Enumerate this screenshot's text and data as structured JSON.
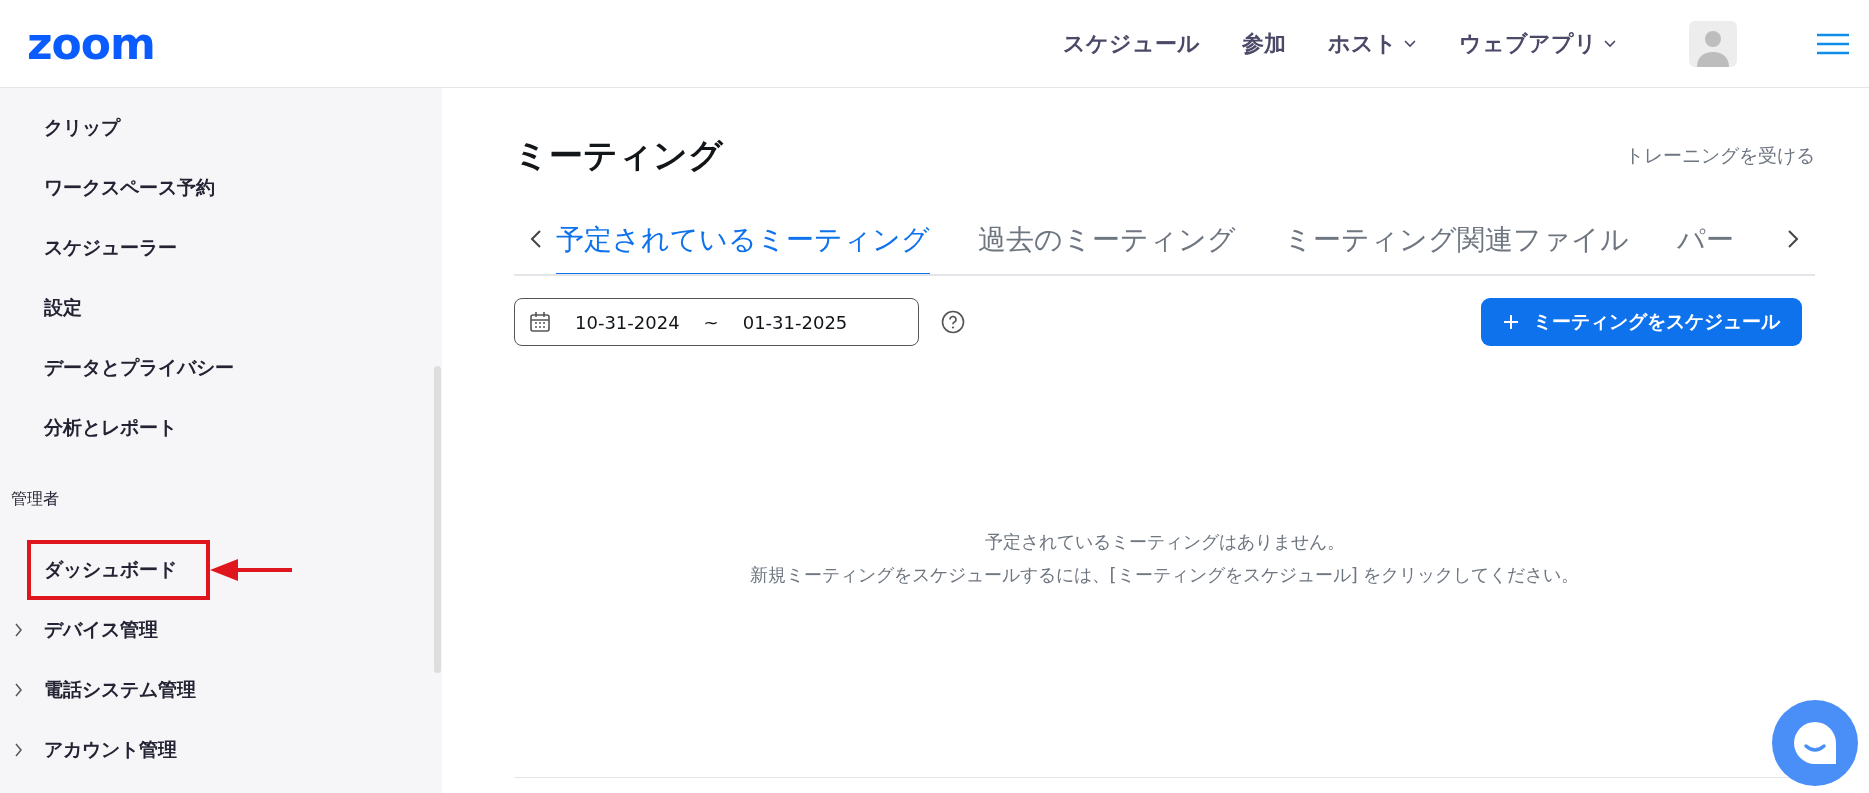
{
  "header": {
    "logo": "zoom",
    "nav": [
      {
        "label": "スケジュール",
        "dropdown": false
      },
      {
        "label": "参加",
        "dropdown": false
      },
      {
        "label": "ホスト",
        "dropdown": true
      },
      {
        "label": "ウェブアプリ",
        "dropdown": true
      }
    ]
  },
  "sidebar": {
    "entries": [
      {
        "kind": "item",
        "label": "クリップ",
        "highlighted": false
      },
      {
        "kind": "item",
        "label": "ワークスペース予約",
        "highlighted": false
      },
      {
        "kind": "item",
        "label": "スケジューラー",
        "highlighted": false
      },
      {
        "kind": "item",
        "label": "設定",
        "highlighted": false
      },
      {
        "kind": "item",
        "label": "データとプライバシー",
        "highlighted": false
      },
      {
        "kind": "item",
        "label": "分析とレポート",
        "highlighted": false
      },
      {
        "kind": "heading",
        "label": "管理者"
      },
      {
        "kind": "item",
        "label": "ダッシュボード",
        "highlighted": true
      },
      {
        "kind": "group",
        "label": "デバイス管理",
        "expanded": false,
        "highlighted": false
      },
      {
        "kind": "group",
        "label": "電話システム管理",
        "expanded": false,
        "highlighted": false
      },
      {
        "kind": "group",
        "label": "アカウント管理",
        "expanded": false,
        "highlighted": false
      }
    ]
  },
  "main": {
    "title": "ミーティング",
    "training_link": "トレーニングを受ける",
    "tabs": [
      {
        "label": "予定されているミーティング",
        "selected": true
      },
      {
        "label": "過去のミーティング",
        "selected": false
      },
      {
        "label": "ミーティング関連ファイル",
        "selected": false
      },
      {
        "label": "パー",
        "selected": false
      }
    ],
    "date_range": {
      "start": "10-31-2024",
      "separator": "~",
      "end": "01-31-2025"
    },
    "schedule_button": "ミーティングをスケジュール",
    "empty_message": [
      "予定されているミーティングはありません。",
      "新規ミーティングをスケジュールするには、[ミーティングをスケジュール] をクリックしてください。"
    ]
  }
}
